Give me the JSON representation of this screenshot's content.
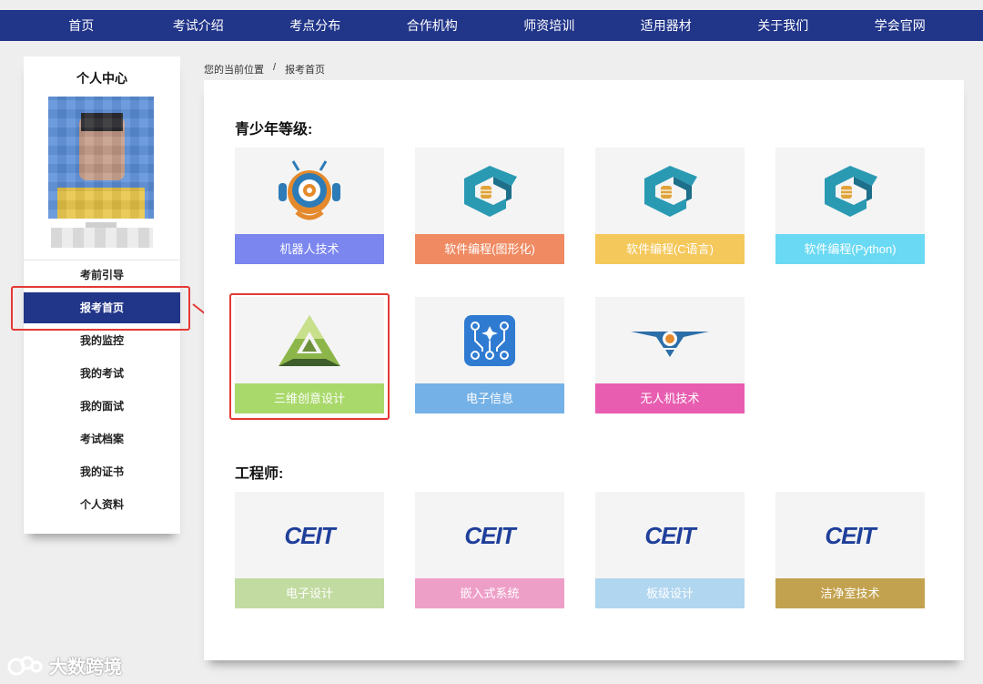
{
  "nav": {
    "items": [
      "首页",
      "考试介绍",
      "考点分布",
      "合作机构",
      "师资培训",
      "适用器材",
      "关于我们",
      "学会官网"
    ]
  },
  "sidebar": {
    "title": "个人中心",
    "menu": [
      "考前引导",
      "报考首页",
      "我的监控",
      "我的考试",
      "我的面试",
      "考试档案",
      "我的证书",
      "个人资料"
    ],
    "active": "报考首页"
  },
  "breadcrumb": {
    "prefix": "您的当前位置",
    "separator": "/",
    "current": "报考首页"
  },
  "sections": {
    "youth": {
      "title": "青少年等级:",
      "cards": [
        {
          "label": "机器人技术",
          "color": "#7b86ef",
          "icon": "robot-icon"
        },
        {
          "label": "软件编程(图形化)",
          "color": "#ef8a62",
          "icon": "code-logo-icon"
        },
        {
          "label": "软件编程(C语言)",
          "color": "#f5c85b",
          "icon": "code-logo-icon"
        },
        {
          "label": "软件编程(Python)",
          "color": "#6ad9f3",
          "icon": "code-logo-icon"
        },
        {
          "label": "三维创意设计",
          "color": "#a9d96b",
          "icon": "triangle-3d-icon"
        },
        {
          "label": "电子信息",
          "color": "#74b1e6",
          "icon": "circuit-icon"
        },
        {
          "label": "无人机技术",
          "color": "#e85db0",
          "icon": "drone-icon"
        }
      ]
    },
    "engineer": {
      "title": "工程师:",
      "cards": [
        {
          "label": "电子设计",
          "color": "#c2dba1",
          "icon": "ceit-logo-icon",
          "logo": "CEIT"
        },
        {
          "label": "嵌入式系统",
          "color": "#ee9fc8",
          "icon": "ceit-logo-icon",
          "logo": "CEIT"
        },
        {
          "label": "板级设计",
          "color": "#b1d6ef",
          "icon": "ceit-logo-icon",
          "logo": "CEIT"
        },
        {
          "label": "洁净室技术",
          "color": "#c3a24f",
          "icon": "ceit-logo-icon",
          "logo": "CEIT"
        }
      ]
    }
  },
  "watermark": "大数跨境",
  "colors": {
    "nav_bg": "#213589",
    "highlight": "#e53935"
  }
}
